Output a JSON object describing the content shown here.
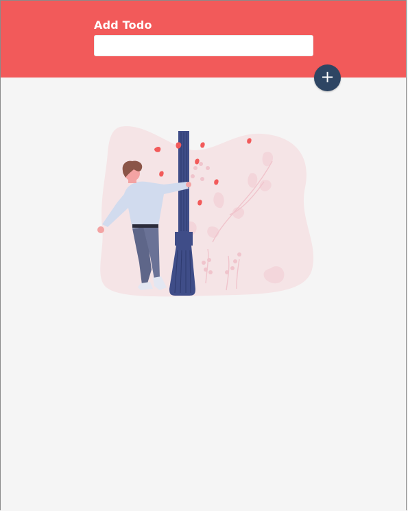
{
  "header": {
    "title": "Add Todo",
    "input_value": "",
    "add_button_icon": "plus-icon",
    "add_button_label": "+"
  },
  "empty_state": {
    "illustration": "person-hugging-lamppost-illustration"
  },
  "colors": {
    "header_bg": "#f25a5a",
    "page_bg": "#f5f5f5",
    "add_button_bg": "#2e4563",
    "illustration_accent": "#f25a5a",
    "lamppost": "#3f4d88",
    "blob": "#f5e4e6"
  }
}
